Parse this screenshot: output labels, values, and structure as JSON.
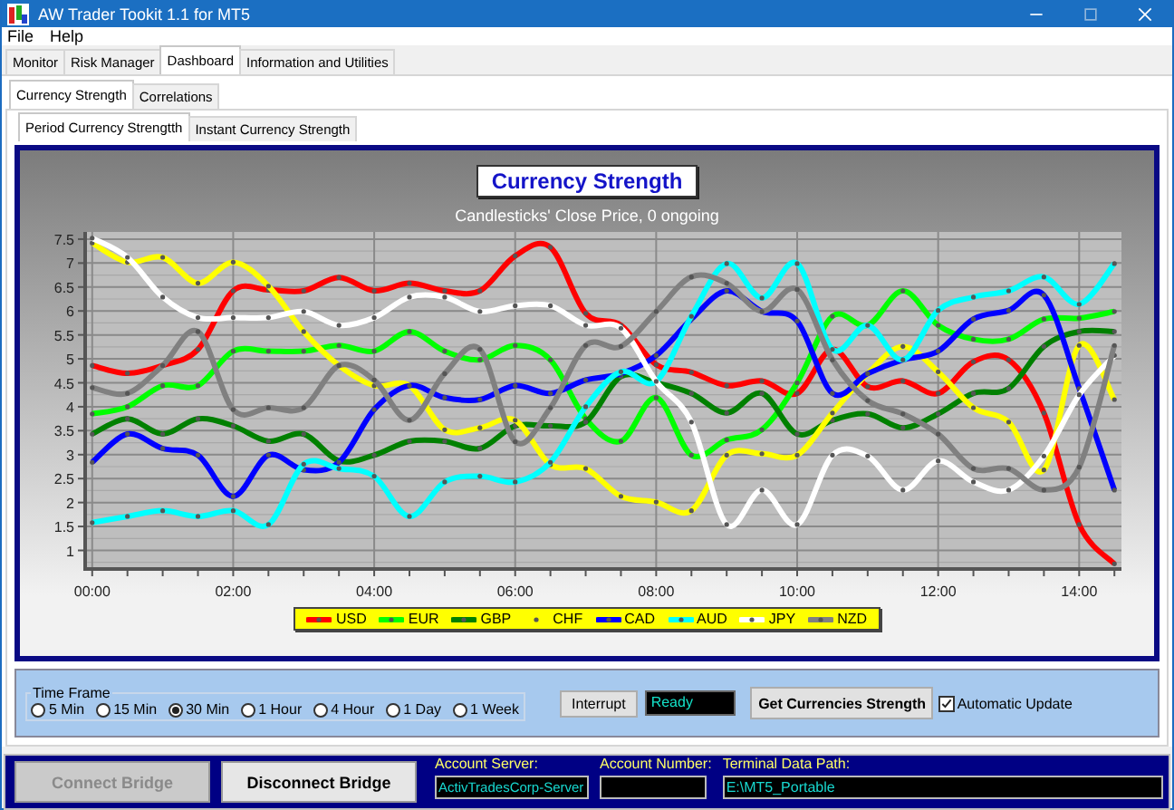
{
  "window": {
    "title": "AW Trader Tookit 1.1 for MT5"
  },
  "menu": [
    "File",
    "Help"
  ],
  "tabs": [
    {
      "label": "Monitor",
      "selected": false
    },
    {
      "label": "Risk Manager",
      "selected": false
    },
    {
      "label": "Dashboard",
      "selected": true
    },
    {
      "label": "Information and Utilities",
      "selected": false
    }
  ],
  "sub_tabs": [
    {
      "label": "Currency Strength",
      "selected": true
    },
    {
      "label": "Correlations",
      "selected": false
    }
  ],
  "view_tabs": [
    {
      "label": "Period Currency Strengtth",
      "selected": true
    },
    {
      "label": "Instant Currency Strength",
      "selected": false
    }
  ],
  "chart": {
    "title": "Currency Strength",
    "subtitle": "Candlesticks' Close Price, 0 ongoing",
    "chart_data": {
      "type": "line",
      "x": [
        0,
        0.5,
        1,
        1.5,
        2,
        2.5,
        3,
        3.5,
        4,
        4.5,
        5,
        5.5,
        6,
        6.5,
        7,
        7.5,
        8,
        8.5,
        9,
        9.5,
        10,
        10.5,
        11,
        11.5,
        12,
        12.5,
        13,
        13.5,
        14,
        14.5
      ],
      "xlim": [
        -0.1,
        14.6
      ],
      "grid": true,
      "ylim": [
        0.65,
        7.65
      ],
      "xticks": [
        {
          "value": 0,
          "label": "00:00"
        },
        {
          "value": 2,
          "label": "02:00"
        },
        {
          "value": 4,
          "label": "04:00"
        },
        {
          "value": 6,
          "label": "06:00"
        },
        {
          "value": 8,
          "label": "08:00"
        },
        {
          "value": 10,
          "label": "10:00"
        },
        {
          "value": 12,
          "label": "12:00"
        },
        {
          "value": 14,
          "label": "14:00"
        }
      ],
      "yticks": [
        1,
        1.5,
        2,
        2.5,
        3,
        3.5,
        4,
        4.5,
        5,
        5.5,
        6,
        6.5,
        7,
        7.5
      ],
      "series": [
        {
          "name": "USD",
          "color": "#ff0000",
          "values": [
            4.86,
            4.7,
            4.86,
            5.2,
            6.42,
            6.44,
            6.42,
            6.7,
            6.42,
            6.58,
            6.42,
            6.42,
            7.15,
            7.33,
            5.95,
            5.7,
            4.88,
            4.72,
            4.44,
            4.54,
            4.28,
            5.2,
            4.42,
            4.54,
            4.28,
            4.94,
            4.98,
            3.87,
            1.54,
            0.72
          ]
        },
        {
          "name": "EUR",
          "color": "#00ff00",
          "values": [
            3.85,
            4.0,
            4.44,
            4.44,
            5.16,
            5.16,
            5.16,
            5.28,
            5.16,
            5.57,
            5.16,
            4.98,
            5.28,
            4.98,
            3.75,
            3.28,
            4.19,
            2.99,
            3.31,
            3.52,
            4.5,
            5.89,
            5.7,
            6.42,
            5.7,
            5.41,
            5.41,
            5.83,
            5.85,
            5.99
          ]
        },
        {
          "name": "GBP",
          "color": "#008000",
          "values": [
            3.43,
            3.75,
            3.43,
            3.75,
            3.6,
            3.28,
            3.43,
            2.87,
            2.99,
            3.28,
            3.28,
            3.13,
            3.6,
            3.6,
            3.68,
            4.63,
            4.5,
            4.28,
            3.87,
            4.28,
            3.43,
            3.72,
            3.85,
            3.56,
            3.85,
            4.28,
            4.38,
            5.26,
            5.57,
            5.57
          ]
        },
        {
          "name": "CHF",
          "color": "#ffff00",
          "values": [
            7.42,
            7.02,
            7.12,
            6.58,
            7.02,
            6.52,
            5.57,
            4.86,
            4.44,
            4.44,
            3.52,
            3.56,
            3.72,
            2.79,
            2.71,
            2.13,
            2.01,
            1.83,
            2.99,
            3.02,
            2.99,
            3.87,
            4.69,
            5.26,
            4.73,
            3.98,
            3.68,
            2.68,
            5.28,
            4.15
          ]
        },
        {
          "name": "CAD",
          "color": "#0000ff",
          "values": [
            2.84,
            3.43,
            3.13,
            2.99,
            2.13,
            2.99,
            2.68,
            2.84,
            3.94,
            4.44,
            4.19,
            4.15,
            4.44,
            4.28,
            4.56,
            4.69,
            5.07,
            5.83,
            6.42,
            5.99,
            5.79,
            4.28,
            4.69,
            4.98,
            5.16,
            5.83,
            6.01,
            6.33,
            4.38,
            2.26
          ]
        },
        {
          "name": "AUD",
          "color": "#00ffff",
          "values": [
            1.58,
            1.71,
            1.83,
            1.71,
            1.83,
            1.54,
            2.8,
            2.71,
            2.55,
            1.71,
            2.43,
            2.55,
            2.43,
            2.84,
            4.0,
            4.73,
            4.53,
            5.89,
            6.99,
            6.27,
            6.99,
            5.2,
            5.7,
            4.98,
            6.01,
            6.29,
            6.42,
            6.71,
            6.14,
            6.99
          ]
        },
        {
          "name": "JPY",
          "color": "#ffffff",
          "values": [
            7.52,
            7.12,
            6.29,
            5.86,
            5.86,
            5.86,
            5.99,
            5.7,
            5.86,
            6.29,
            6.29,
            5.99,
            6.11,
            6.11,
            5.7,
            5.64,
            4.53,
            3.68,
            1.54,
            2.26,
            1.54,
            2.99,
            2.97,
            2.26,
            2.87,
            2.43,
            2.26,
            2.97,
            4.25,
            5.07
          ]
        },
        {
          "name": "NZD",
          "color": "#808080",
          "values": [
            4.4,
            4.28,
            4.86,
            5.57,
            3.94,
            3.98,
            3.98,
            4.86,
            4.56,
            3.72,
            4.69,
            5.2,
            3.27,
            3.98,
            5.28,
            5.26,
            5.99,
            6.71,
            6.58,
            5.99,
            6.45,
            4.98,
            4.13,
            3.85,
            3.43,
            2.71,
            2.71,
            2.26,
            2.74,
            5.28
          ]
        }
      ]
    }
  },
  "time_frame": {
    "label": "Time Frame",
    "options": [
      {
        "label": "5 Min",
        "selected": false
      },
      {
        "label": "15 Min",
        "selected": false
      },
      {
        "label": "30 Min",
        "selected": true
      },
      {
        "label": "1 Hour",
        "selected": false
      },
      {
        "label": "4 Hour",
        "selected": false
      },
      {
        "label": "1 Day",
        "selected": false
      },
      {
        "label": "1 Week",
        "selected": false
      }
    ]
  },
  "interrupt_button": "Interrupt",
  "status_field": {
    "value": "Ready"
  },
  "get_button": "Get Currencies Strength",
  "auto_update": {
    "label": "Automatic Update",
    "checked": true
  },
  "bridge_buttons": [
    {
      "label": "Connect Bridge",
      "disabled": true
    },
    {
      "label": "Disconnect Bridge",
      "disabled": false
    }
  ],
  "bridge_fields": [
    {
      "label": "Account Server:",
      "value": "ActivTradesCorp-Server"
    },
    {
      "label": "Account Number:"
    },
    {
      "label": "Terminal Data Path:",
      "value": "E:\\MT5_Portable"
    }
  ]
}
